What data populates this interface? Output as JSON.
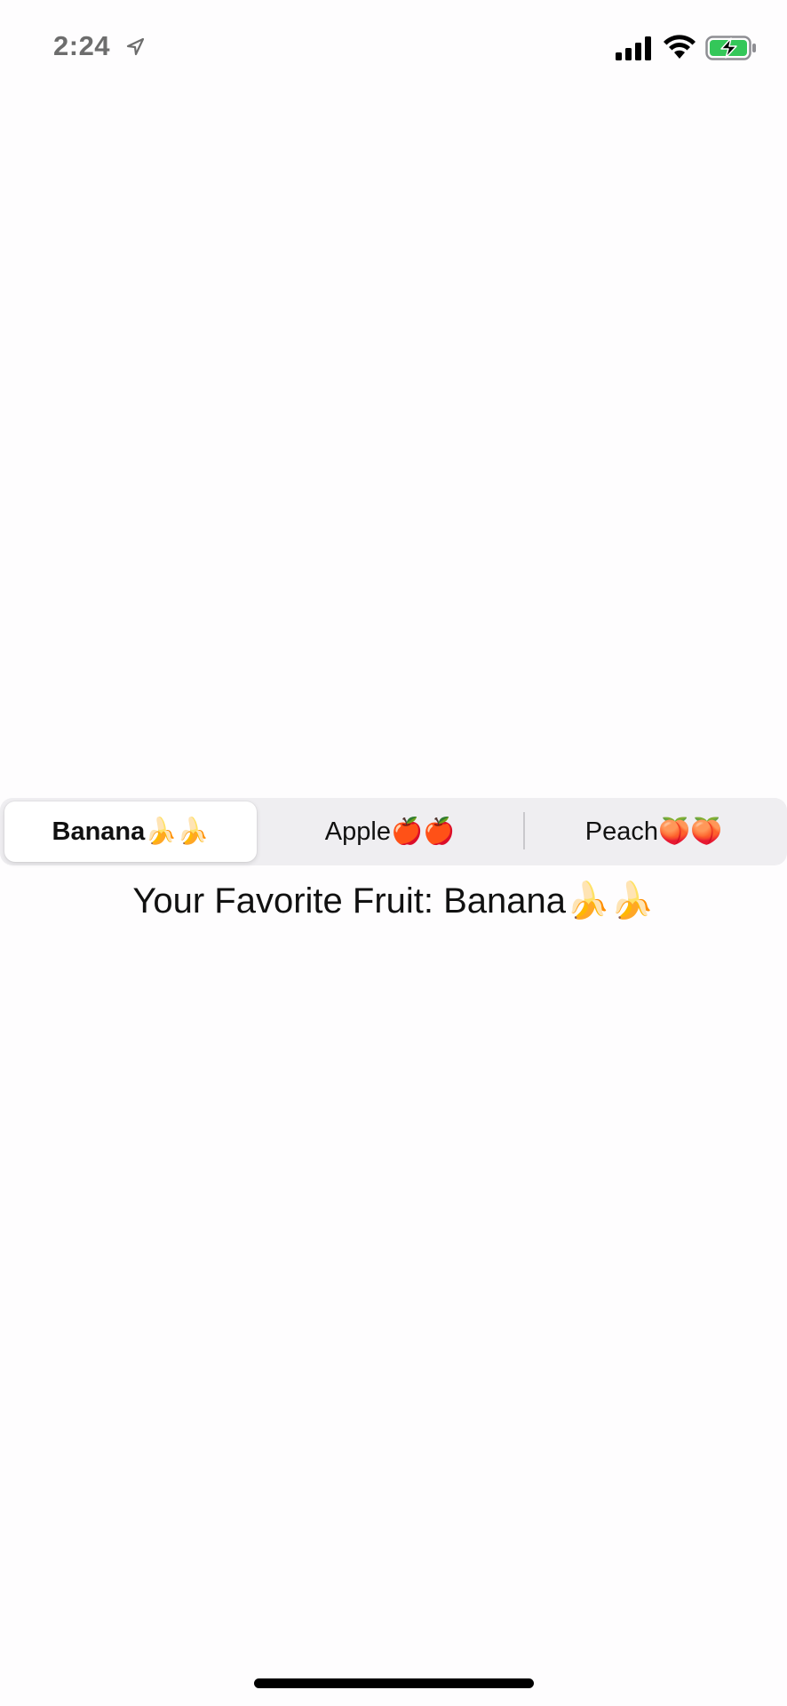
{
  "status_bar": {
    "time": "2:24",
    "battery_color": "#34c759"
  },
  "segmented_control": {
    "items": [
      {
        "label": "Banana🍌🍌",
        "selected": true
      },
      {
        "label": "Apple🍎🍎",
        "selected": false
      },
      {
        "label": "Peach🍑🍑",
        "selected": false
      }
    ]
  },
  "favorite": {
    "text": "Your Favorite Fruit: Banana🍌🍌"
  }
}
